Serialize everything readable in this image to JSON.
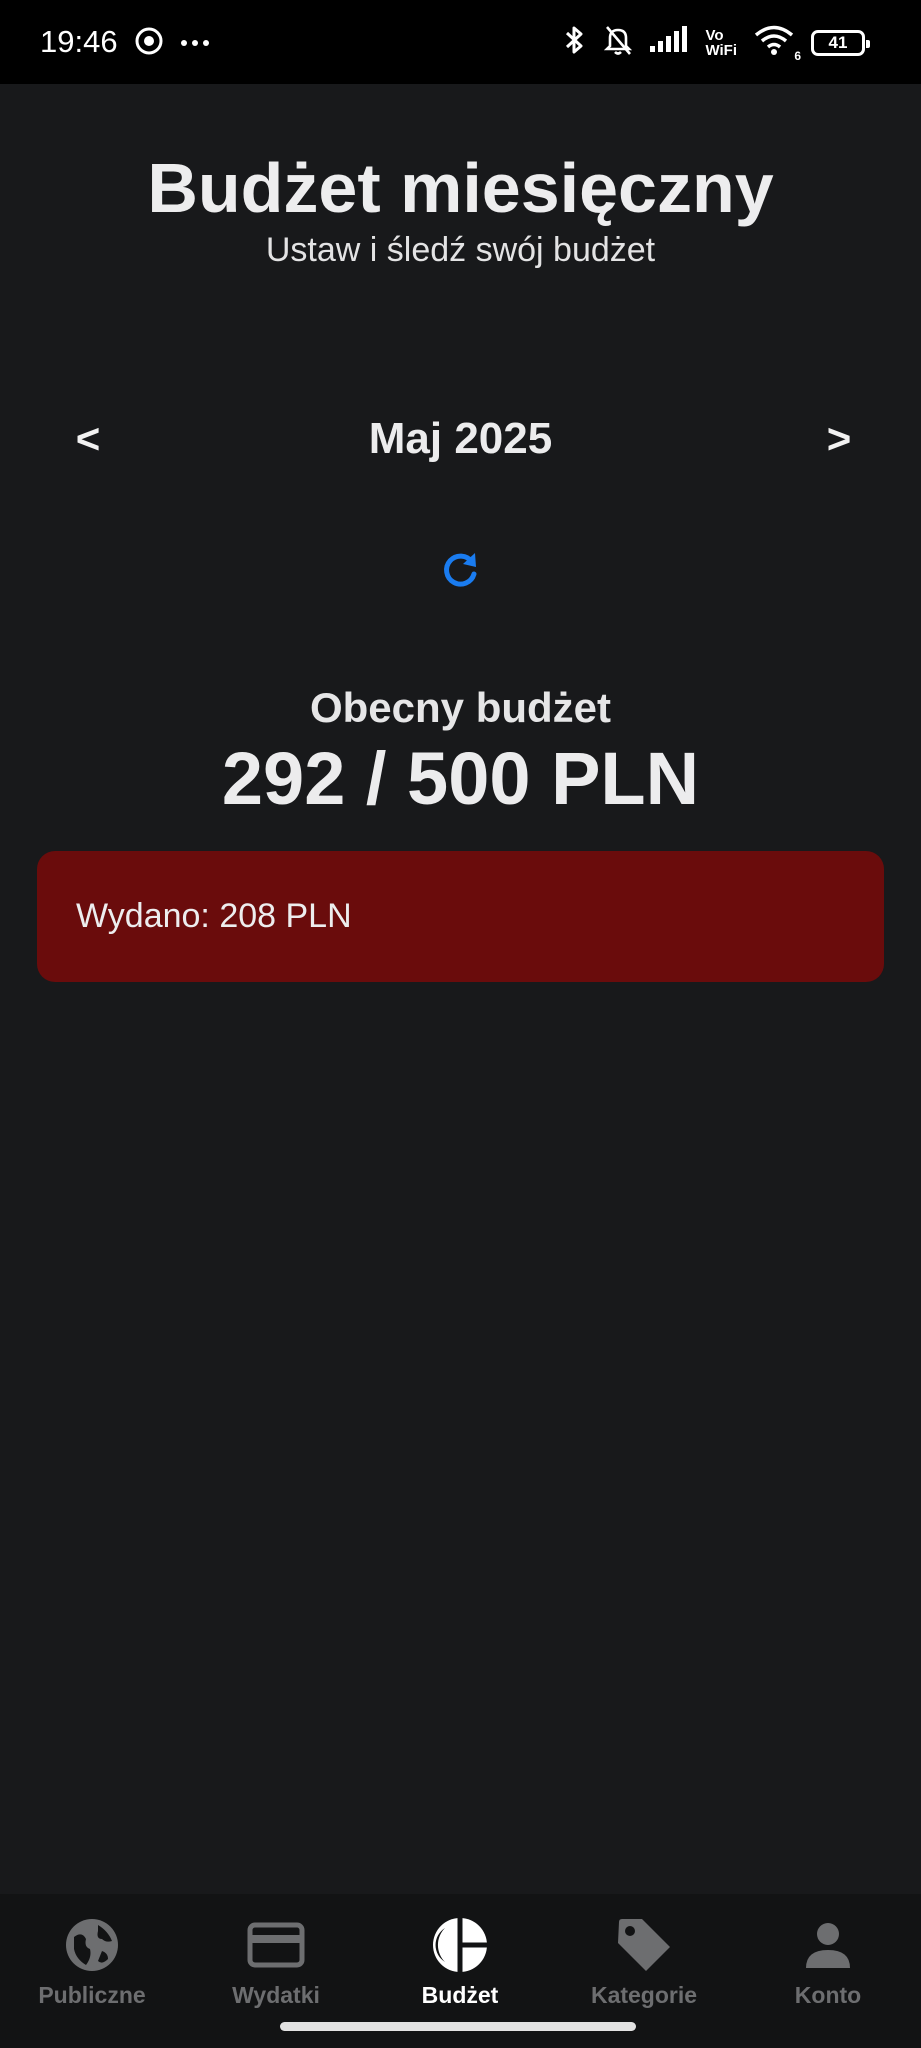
{
  "status_bar": {
    "time": "19:46",
    "network_label_top": "Vo",
    "network_label_bottom": "WiFi",
    "wifi_sub": "6",
    "battery": "41"
  },
  "header": {
    "title": "Budżet miesięczny",
    "subtitle": "Ustaw i śledź swój budżet"
  },
  "month_nav": {
    "prev_label": "<",
    "month": "Maj 2025",
    "next_label": ">"
  },
  "budget": {
    "label": "Obecny budżet",
    "value": "292 / 500 PLN"
  },
  "spent": {
    "text": "Wydano: 208 PLN"
  },
  "bottom_nav": {
    "items": [
      {
        "label": "Publiczne",
        "icon": "globe-icon",
        "active": false
      },
      {
        "label": "Wydatki",
        "icon": "credit-card-icon",
        "active": false
      },
      {
        "label": "Budżet",
        "icon": "pie-chart-icon",
        "active": true
      },
      {
        "label": "Kategorie",
        "icon": "tag-icon",
        "active": false
      },
      {
        "label": "Konto",
        "icon": "person-icon",
        "active": false
      }
    ]
  },
  "colors": {
    "background": "#18191b",
    "accent": "#1a7cf0",
    "spent_card": "#6a0c0c",
    "nav_inactive": "#6d6e70"
  }
}
